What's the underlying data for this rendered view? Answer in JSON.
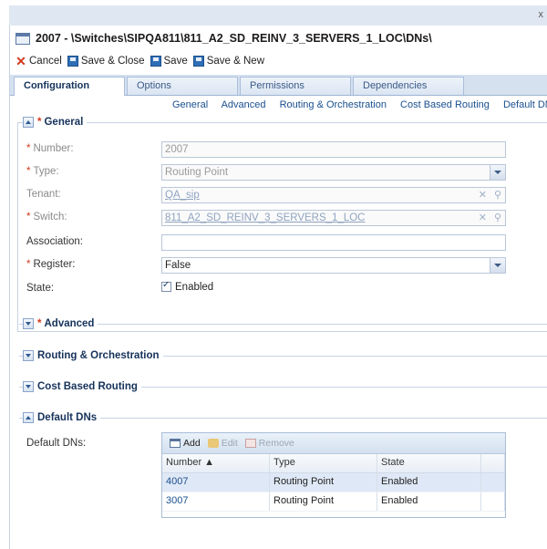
{
  "window": {
    "title": "2007 - \\Switches\\SIPQA811\\811_A2_SD_REINV_3_SERVERS_1_LOC\\DNs\\",
    "close_glyph": "x"
  },
  "toolbar": {
    "cancel": "Cancel",
    "save_close": "Save & Close",
    "save": "Save",
    "save_new": "Save & New"
  },
  "tabs": [
    "Configuration",
    "Options",
    "Permissions",
    "Dependencies"
  ],
  "active_tab": "Configuration",
  "anchors": [
    "General",
    "Advanced",
    "Routing & Orchestration",
    "Cost Based Routing",
    "Default DNs"
  ],
  "general": {
    "title": "General",
    "number": {
      "label": "Number:",
      "value": "2007"
    },
    "type": {
      "label": "Type:",
      "value": "Routing Point"
    },
    "tenant": {
      "label": "Tenant:",
      "value": "QA_sip"
    },
    "switch": {
      "label": "Switch:",
      "value": "811_A2_SD_REINV_3_SERVERS_1_LOC"
    },
    "association": {
      "label": "Association:",
      "value": ""
    },
    "register": {
      "label": "Register:",
      "value": "False"
    },
    "state": {
      "label": "State:",
      "value": "Enabled",
      "checked": true
    }
  },
  "sections": {
    "advanced": "Advanced",
    "routing": "Routing & Orchestration",
    "cost": "Cost Based Routing",
    "default_dns": "Default DNs"
  },
  "default_dns": {
    "label": "Default DNs:",
    "toolbar": {
      "add": "Add",
      "edit": "Edit",
      "remove": "Remove"
    },
    "columns": [
      "Number ▲",
      "Type",
      "State"
    ],
    "rows": [
      {
        "number": "4007",
        "type": "Routing Point",
        "state": "Enabled"
      },
      {
        "number": "3007",
        "type": "Routing Point",
        "state": "Enabled"
      }
    ]
  },
  "colors": {
    "accent": "#15325a",
    "required": "#d23a1c",
    "link": "#1a4f8f"
  }
}
